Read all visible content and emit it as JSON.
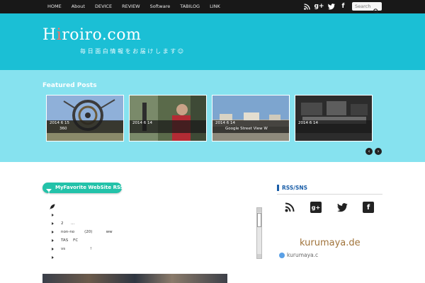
{
  "nav": {
    "items": [
      "HOME",
      "About",
      "DEVICE",
      "REVIEW",
      "Software",
      "TABILOG",
      "LINK"
    ]
  },
  "social": {
    "icons": [
      "rss-icon",
      "google-plus-icon",
      "twitter-icon",
      "facebook-icon"
    ],
    "gplus_glyph": "g+",
    "facebook_glyph": "f"
  },
  "search": {
    "placeholder": "Search"
  },
  "header": {
    "logo_before_dot": "H",
    "logo_dot": "i",
    "logo_after_dot": "roiro.com",
    "tagline": "毎日面白情報をお届けします☺",
    "background": "#1bbfd5",
    "logo_dot_color": "#ff6f61"
  },
  "featured": {
    "title": "Featured Posts",
    "background": "#86e2ef",
    "slides": [
      {
        "date": "2014 6 15",
        "title": "360"
      },
      {
        "date": "2014 6 14",
        "title": ""
      },
      {
        "date": "2014 6 14",
        "title": "Google Street View  W"
      },
      {
        "date": "2014 6 14",
        "title": ""
      }
    ],
    "prev_label": "‹",
    "next_label": "›"
  },
  "widget": {
    "tab_label": "MyFavorite WebSite RSS",
    "tab_color": "#23c2a9",
    "items": [
      "",
      "2      ...",
      "non-no        (20)           ww",
      "TAS    FC",
      "vs                    !",
      ""
    ]
  },
  "sidebar": {
    "title": "RSS/SNS",
    "accent": "#1a5ea8",
    "gplus_glyph": "g+",
    "facebook_glyph": "f",
    "banner_title": "kurumaya.de",
    "banner_url": "kurumaya.c"
  }
}
